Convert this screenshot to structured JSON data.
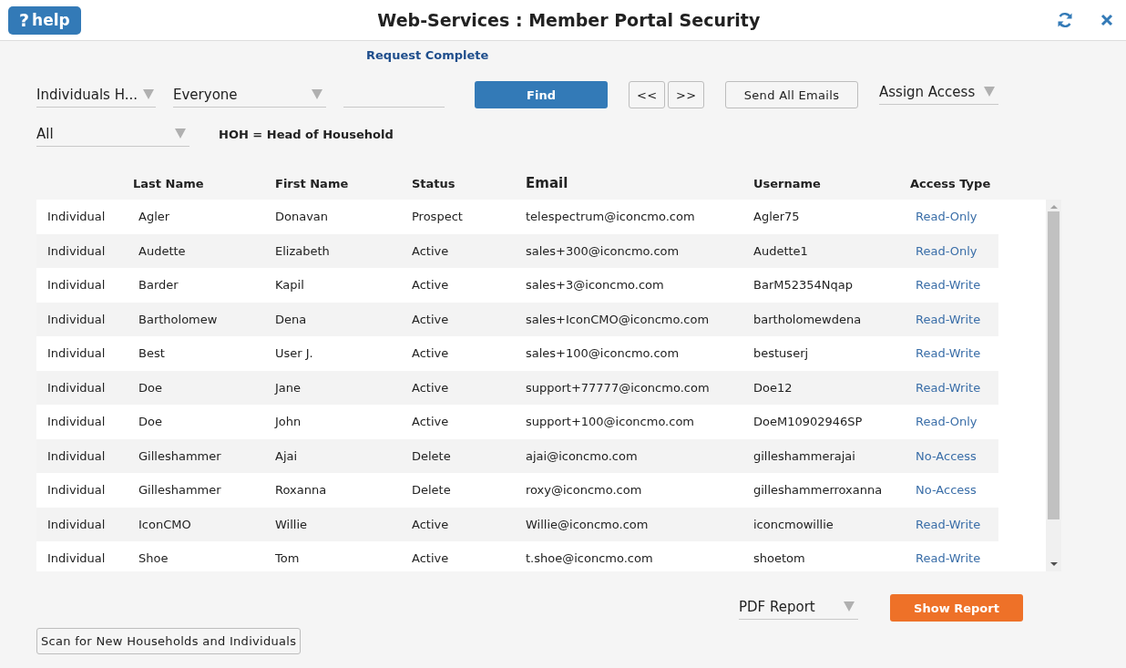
{
  "window": {
    "title": "Web-Services : Member Portal Security"
  },
  "help_button": {
    "icon": "?",
    "label": "help"
  },
  "status_message": "Request Complete",
  "filters": {
    "type_dropdown": "Individuals H...",
    "group_dropdown": "Everyone",
    "find_button": "Find",
    "prev_button": "<<",
    "next_button": ">>",
    "send_emails_button": "Send All Emails",
    "assign_dropdown": "Assign Access",
    "status_dropdown": "All",
    "legend": "HOH = Head of Household"
  },
  "table": {
    "columns": [
      "",
      "Last Name",
      "First Name",
      "Status",
      "Email",
      "Username",
      "Access Type"
    ],
    "rows": [
      {
        "type": "Individual",
        "last": "Agler",
        "first": "Donavan",
        "status": "Prospect",
        "email": "telespectrum@iconcmo.com",
        "username": "Agler75",
        "access": "Read-Only"
      },
      {
        "type": "Individual",
        "last": "Audette",
        "first": "Elizabeth",
        "status": "Active",
        "email": "sales+300@iconcmo.com",
        "username": "Audette1",
        "access": "Read-Only"
      },
      {
        "type": "Individual",
        "last": "Barder",
        "first": "Kapil",
        "status": "Active",
        "email": "sales+3@iconcmo.com",
        "username": "BarM52354Nqap",
        "access": "Read-Write"
      },
      {
        "type": "Individual",
        "last": "Bartholomew",
        "first": "Dena",
        "status": "Active",
        "email": "sales+IconCMO@iconcmo.com",
        "username": "bartholomewdena",
        "access": "Read-Write"
      },
      {
        "type": "Individual",
        "last": "Best",
        "first": "User J.",
        "status": "Active",
        "email": "sales+100@iconcmo.com",
        "username": "bestuserj",
        "access": "Read-Write"
      },
      {
        "type": "Individual",
        "last": "Doe",
        "first": "Jane",
        "status": "Active",
        "email": "support+77777@iconcmo.com",
        "username": "Doe12",
        "access": "Read-Write"
      },
      {
        "type": "Individual",
        "last": "Doe",
        "first": "John",
        "status": "Active",
        "email": "support+100@iconcmo.com",
        "username": "DoeM10902946SP",
        "access": "Read-Only"
      },
      {
        "type": "Individual",
        "last": "Gilleshammer",
        "first": "Ajai",
        "status": "Delete",
        "email": "ajai@iconcmo.com",
        "username": "gilleshammerajai",
        "access": "No-Access"
      },
      {
        "type": "Individual",
        "last": "Gilleshammer",
        "first": "Roxanna",
        "status": "Delete",
        "email": "roxy@iconcmo.com",
        "username": "gilleshammerroxanna",
        "access": "No-Access"
      },
      {
        "type": "Individual",
        "last": "IconCMO",
        "first": "Willie",
        "status": "Active",
        "email": "Willie@iconcmo.com",
        "username": "iconcmowillie",
        "access": "Read-Write"
      },
      {
        "type": "Individual",
        "last": "Shoe",
        "first": "Tom",
        "status": "Active",
        "email": "t.shoe@iconcmo.com",
        "username": "shoetom",
        "access": "Read-Write"
      }
    ]
  },
  "report": {
    "format_dropdown": "PDF Report",
    "show_button": "Show Report"
  },
  "scan_button": "Scan for New Households and Individuals"
}
